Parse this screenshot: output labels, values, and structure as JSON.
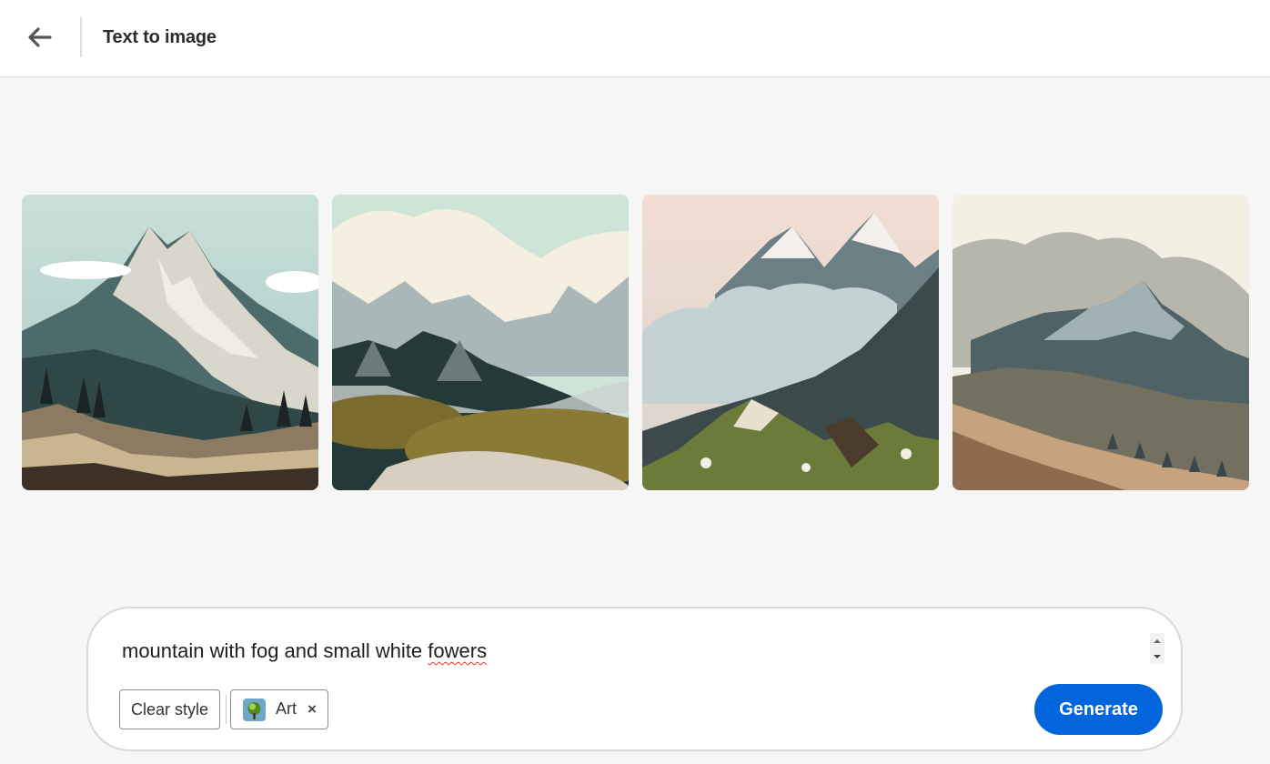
{
  "header": {
    "title": "Text to image",
    "back_icon": "arrow-left-icon"
  },
  "gallery": {
    "images": [
      {
        "palette": "teal-sky-snowy-peaks-forest"
      },
      {
        "palette": "mint-sky-clouds-green-hills"
      },
      {
        "palette": "peach-sky-fog-mossy-hills"
      },
      {
        "palette": "cream-sky-clouds-rocky-slopes"
      }
    ]
  },
  "prompt": {
    "text_before": "mountain with fog and small white ",
    "misspelled_word": "fowers",
    "scroll_up_icon": "caret-up-icon",
    "scroll_down_icon": "caret-down-icon"
  },
  "controls": {
    "clear_style_label": "Clear style",
    "style_chip": {
      "label": "Art",
      "thumb_icon": "art-style-thumbnail",
      "close_icon": "close-icon",
      "close_glyph": "×"
    },
    "generate_label": "Generate"
  },
  "colors": {
    "accent": "#0265dc",
    "background": "#f6f6f6",
    "panel_border": "#d9d9d9"
  }
}
